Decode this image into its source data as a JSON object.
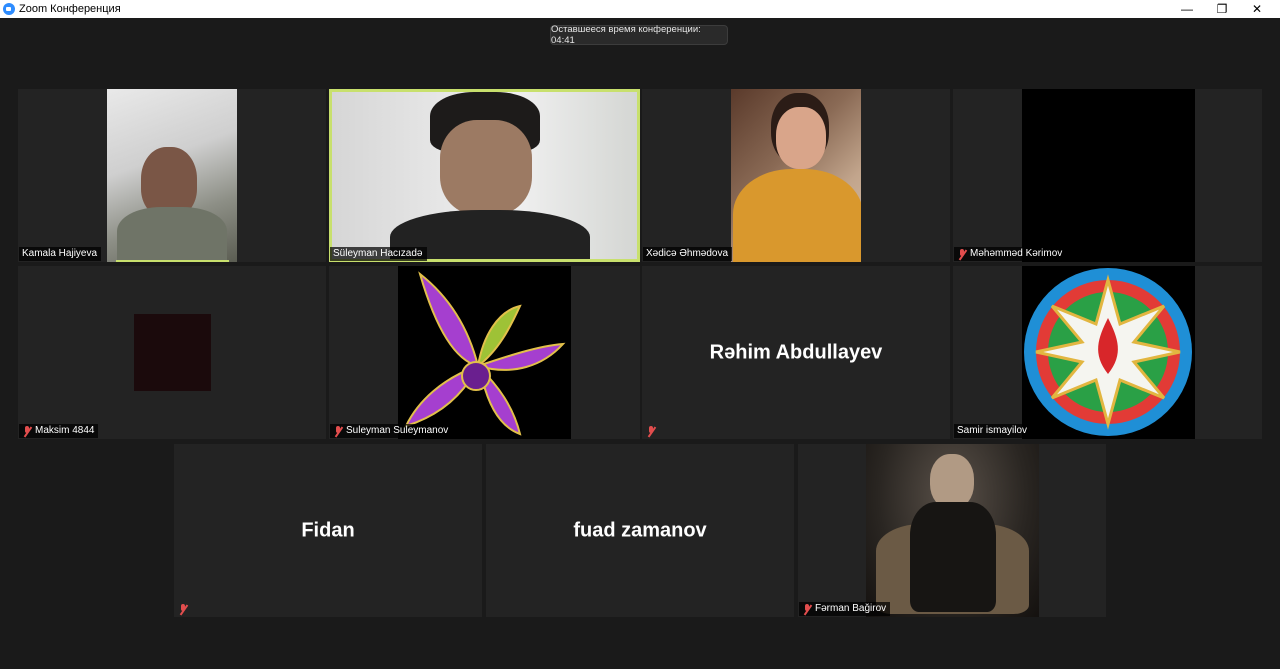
{
  "window": {
    "title": "Zoom Конференция",
    "min": "—",
    "max": "❐",
    "close": "✕"
  },
  "timer": "Оставшееся время конференции: 04:41",
  "participants": [
    {
      "name": "Kamala Hajiyeva",
      "muted": false
    },
    {
      "name": "Süleyman Hacızadə",
      "muted": false
    },
    {
      "name": "Xədicə Əhmədova",
      "muted": false
    },
    {
      "name": "Məhəmməd Kərimov",
      "muted": true
    },
    {
      "name": "Maksim 4844",
      "muted": true
    },
    {
      "name": "Suleyman Suleymanov",
      "muted": true
    },
    {
      "name": "",
      "display_name": "Rəhim Abdullayev",
      "muted": true
    },
    {
      "name": "Samir ismayilov",
      "muted": false
    },
    {
      "name": "",
      "display_name": "Fidan",
      "muted": true
    },
    {
      "name": "",
      "display_name": "fuad zamanov",
      "muted": false
    },
    {
      "name": "Fərman Bağirov",
      "muted": true
    }
  ],
  "colors": {
    "active_speaker": "#c8e06d",
    "background": "#1a1a1a",
    "tile": "#232323",
    "mute": "#e24d4d"
  }
}
